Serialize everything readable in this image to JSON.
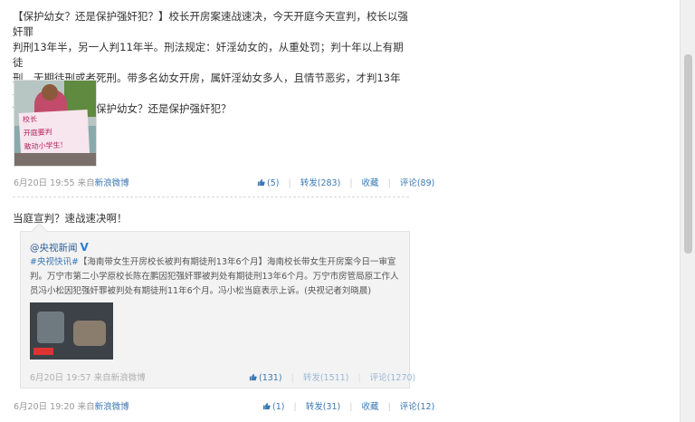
{
  "post1": {
    "text_lines": [
      "【保护幼女？还是保护强奸犯？】校长开房案速战速决，今天开庭今天宣判，校长以强奸罪",
      "判刑13年半，另一人判11年半。刑法规定：奸淫幼女的，从重处罚；判十年以上有期徒",
      "刑、无期徒刑或者死刑。带多名幼女开房，属奸淫幼女多人，且情节恶劣，才判13年半。",
      "请问法官：你们是保护幼女？还是保护强奸犯？"
    ],
    "photo_sign": [
      "校长",
      "开庭要判",
      "敢动小学生!"
    ],
    "time": "6月20日 19:55",
    "source_prefix": "来自",
    "source": "新浪微博",
    "like": "(5)",
    "repost": "转发(283)",
    "favorite": "收藏",
    "comment": "评论(89)"
  },
  "post2": {
    "text": "当庭宣判？速战速决啊！",
    "repost": {
      "author": "@央视新闻",
      "verified": "V",
      "text_tag": "#央视快讯#",
      "text_lines": [
        "【海南带女生开房校长被判有期徒刑13年6个月】海南校长带女生开房案今日一审宣",
        "判。万宁市第二小学原校长陈在鹏因犯强奸罪被判处有期徒刑13年6个月。万宁市房管局原工作人",
        "员冯小松因犯强奸罪被判处有期徒刑11年6个月。冯小松当庭表示上诉。(央视记者刘晓晨)"
      ],
      "thumb_label": "BREAKING",
      "time": "6月20日 19:57",
      "source_prefix": "来自",
      "source": "新浪微博",
      "like": "(131)",
      "repost": "转发(1511)",
      "comment": "评论(1270)"
    },
    "time": "6月20日 19:20",
    "source_prefix": "来自",
    "source": "新浪微博",
    "like": "(1)",
    "repost_count": "转发(31)",
    "favorite": "收藏",
    "comment": "评论(12)"
  }
}
